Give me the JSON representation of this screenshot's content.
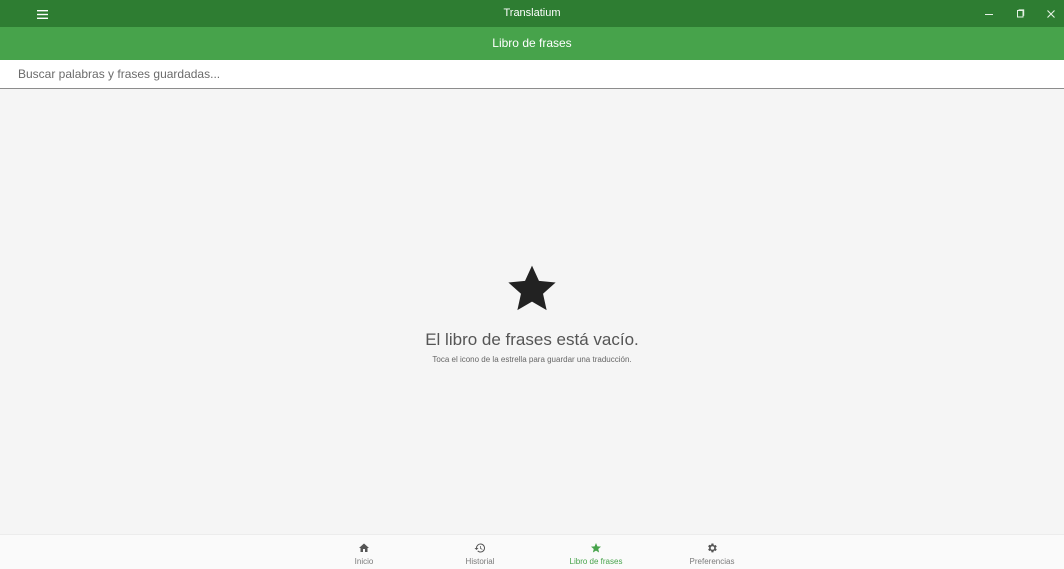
{
  "window": {
    "title": "Translatium",
    "menu_icon": "menu-icon",
    "controls": [
      "minimize-icon",
      "restore-icon",
      "close-icon"
    ]
  },
  "appbar": {
    "title": "Libro de frases"
  },
  "search": {
    "placeholder": "Buscar palabras y frases guardadas...",
    "value": ""
  },
  "empty_state": {
    "icon": "star-icon",
    "heading": "El libro de frases está vacío.",
    "subtext": "Toca el icono de la estrella para guardar una traducción."
  },
  "bottom_nav": {
    "items": [
      {
        "label": "Inicio",
        "icon": "home-icon",
        "active": false
      },
      {
        "label": "Historial",
        "icon": "history-icon",
        "active": false
      },
      {
        "label": "Libro de frases",
        "icon": "star-icon",
        "active": true
      },
      {
        "label": "Preferencias",
        "icon": "gear-icon",
        "active": false
      }
    ]
  },
  "colors": {
    "titlebar": "#2e7d32",
    "appbar": "#47a34b",
    "accent": "#47a34b",
    "background": "#f5f5f5"
  }
}
